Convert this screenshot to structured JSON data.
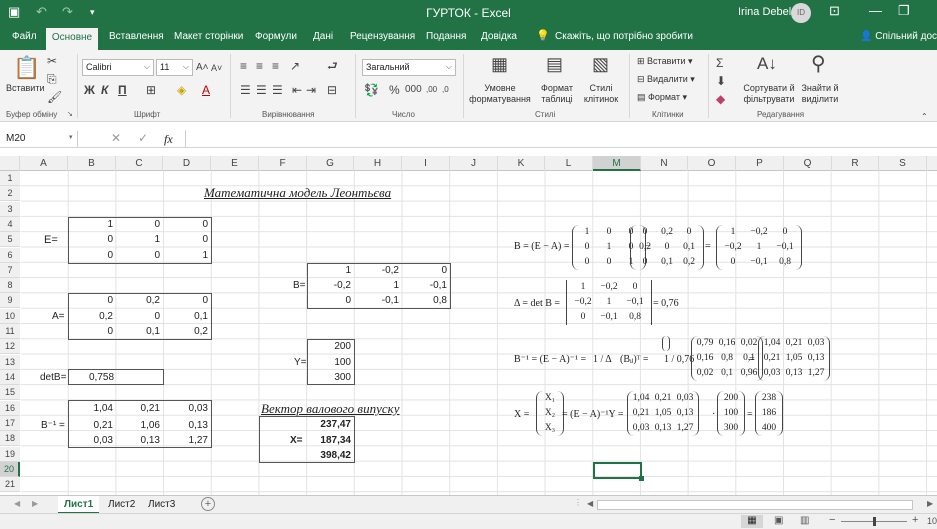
{
  "app": {
    "title": "ГУРТОК  -  Excel",
    "user": "Irina Debela",
    "user_initials": "ID"
  },
  "ribbon_tabs": [
    "Файл",
    "Основне",
    "Вставлення",
    "Макет сторінки",
    "Формули",
    "Дані",
    "Рецензування",
    "Подання",
    "Довідка"
  ],
  "tell_me": "Скажіть, що потрібно зробити",
  "share": "Спільний доступ",
  "groups": {
    "clipboard": "Буфер обміну",
    "font": "Шрифт",
    "align": "Вирівнювання",
    "number": "Число",
    "styles": "Стилі",
    "cells": "Клітинки",
    "editing": "Редагування"
  },
  "buttons": {
    "paste": "Вставити",
    "cond_format": "Умовне форматування",
    "format_table": "Формат таблиці",
    "cell_styles": "Стилі клітинок",
    "insert": "Вставити",
    "delete": "Видалити",
    "format": "Формат",
    "sort_filter": "Сортувати й фільтрувати",
    "find_select": "Знайти й виділити"
  },
  "font": {
    "name": "Calibri",
    "size": "11",
    "bold": "Ж",
    "italic": "К",
    "underline": "П"
  },
  "number_format": "Загальний",
  "formula_bar": {
    "name_box": "M20",
    "fx": "fx",
    "value": ""
  },
  "columns": [
    "A",
    "B",
    "C",
    "D",
    "E",
    "F",
    "G",
    "H",
    "I",
    "J",
    "K",
    "L",
    "M",
    "N",
    "O",
    "P",
    "Q",
    "R",
    "S"
  ],
  "rows": [
    "1",
    "2",
    "3",
    "4",
    "5",
    "6",
    "7",
    "8",
    "9",
    "10",
    "11",
    "12",
    "13",
    "14",
    "15",
    "16",
    "17",
    "18",
    "19",
    "20",
    "21"
  ],
  "sheet": {
    "title": "Математична модель Леонтьєва",
    "E_label": "E=",
    "E": [
      [
        "1",
        "0",
        "0"
      ],
      [
        "0",
        "1",
        "0"
      ],
      [
        "0",
        "0",
        "1"
      ]
    ],
    "A_label": "A=",
    "A": [
      [
        "0",
        "0,2",
        "0"
      ],
      [
        "0,2",
        "0",
        "0,1"
      ],
      [
        "0",
        "0,1",
        "0,2"
      ]
    ],
    "det_label": "detB=",
    "det_value": "0,758",
    "Binv_label": "B⁻¹ =",
    "Binv": [
      [
        "1,04",
        "0,21",
        "0,03"
      ],
      [
        "0,21",
        "1,06",
        "0,13"
      ],
      [
        "0,03",
        "0,13",
        "1,27"
      ]
    ],
    "B_label": "B=",
    "B": [
      [
        "1",
        "-0,2",
        "0"
      ],
      [
        "-0,2",
        "1",
        "-0,1"
      ],
      [
        "0",
        "-0,1",
        "0,8"
      ]
    ],
    "Y_label": "Y=",
    "Y": [
      "200",
      "100",
      "300"
    ],
    "vector_title": "Вектор валового випуску",
    "X_label": "X=",
    "X": [
      "237,47",
      "187,34",
      "398,42"
    ]
  },
  "formulas": {
    "f1_lhs": "B = (E − A) =",
    "f1_E": [
      [
        "1",
        "0",
        "0"
      ],
      [
        "0",
        "1",
        "0"
      ],
      [
        "0",
        "0",
        "1"
      ]
    ],
    "f1_A": [
      [
        "0",
        "0,2",
        "0"
      ],
      [
        "0,2",
        "0",
        "0,1"
      ],
      [
        "0",
        "0,1",
        "0,2"
      ]
    ],
    "f1_B": [
      [
        "1",
        "−0,2",
        "0"
      ],
      [
        "−0,2",
        "1",
        "−0,1"
      ],
      [
        "0",
        "−0,1",
        "0,8"
      ]
    ],
    "minus": "−",
    "equals": "=",
    "f2_lhs": "Δ = det B =",
    "f2_rhs": "= 0,76",
    "f3_lhs": "B⁻¹ = (E − A)⁻¹ = ",
    "f3_frac": "1 / Δ",
    "f3_mid": "(Bᵢⱼ)ᵀ =",
    "f3_coef": "1 / 0,76",
    "f3_adj": [
      [
        "0,79",
        "0,16",
        "0,02"
      ],
      [
        "0,16",
        "0,8",
        "0,1"
      ],
      [
        "0,02",
        "0,1",
        "0,96"
      ]
    ],
    "f3_res": [
      [
        "1,04",
        "0,21",
        "0,03"
      ],
      [
        "0,21",
        "1,05",
        "0,13"
      ],
      [
        "0,03",
        "0,13",
        "1,27"
      ]
    ],
    "f4_lhs": "X =",
    "f4_X": [
      "X₁",
      "X₂",
      "X₃"
    ],
    "f4_mid": "= (E − A)⁻¹Y =",
    "f4_M": [
      [
        "1,04",
        "0,21",
        "0,03"
      ],
      [
        "0,21",
        "1,05",
        "0,13"
      ],
      [
        "0,03",
        "0,13",
        "1,27"
      ]
    ],
    "f4_Y": [
      "200",
      "100",
      "300"
    ],
    "dot": "·",
    "f4_res": [
      "238",
      "186",
      "400"
    ]
  },
  "sheet_tabs": [
    "Лист1",
    "Лист2",
    "Лист3"
  ],
  "zoom": "10"
}
